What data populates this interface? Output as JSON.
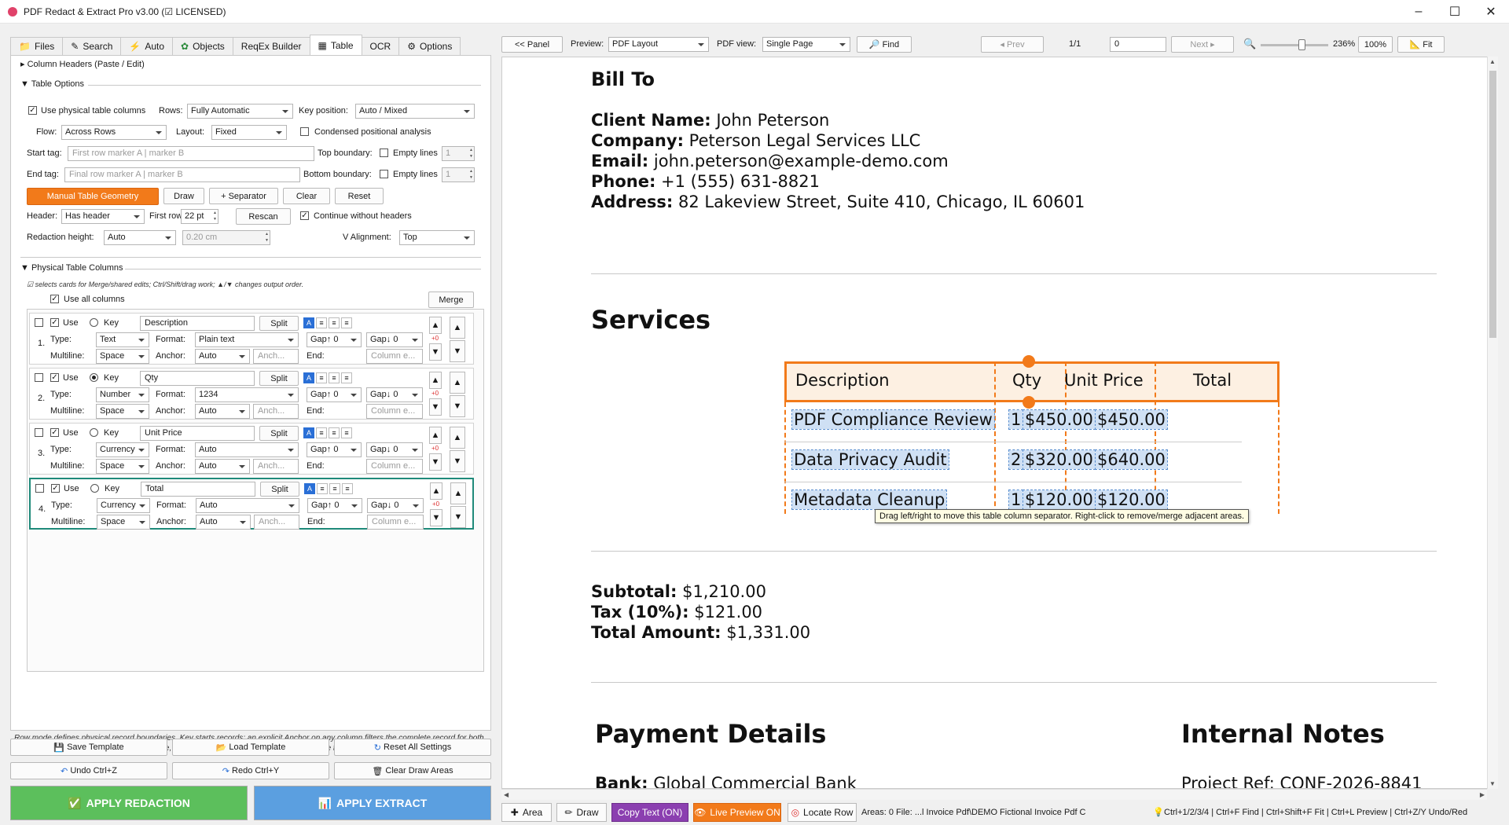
{
  "window": {
    "title": "PDF Redact & Extract Pro v3.00 (☑ LICENSED)"
  },
  "tabs": [
    {
      "label": "Files",
      "icon": "folder-icon"
    },
    {
      "label": "Search",
      "icon": "search-icon"
    },
    {
      "label": "Auto",
      "icon": "lightning-icon"
    },
    {
      "label": "Objects",
      "icon": "objects-icon"
    },
    {
      "label": "ReqEx Builder",
      "icon": ""
    },
    {
      "label": "Table",
      "icon": "table-icon"
    },
    {
      "label": "OCR",
      "icon": ""
    },
    {
      "label": "Options",
      "icon": "gear-icon"
    }
  ],
  "column_headers_section": "Column Headers (Paste / Edit)",
  "table_options": {
    "section": "Table Options",
    "use_physical": "Use physical table columns",
    "rows_label": "Rows:",
    "rows_value": "Fully Automatic",
    "key_position_label": "Key position:",
    "key_position_value": "Auto / Mixed",
    "flow_label": "Flow:",
    "flow_value": "Across Rows",
    "layout_label": "Layout:",
    "layout_value": "Fixed",
    "condensed": "Condensed positional analysis",
    "start_tag_label": "Start tag:",
    "start_tag_placeholder": "First row marker A | marker B",
    "top_boundary_label": "Top boundary:",
    "empty_lines": "Empty lines",
    "top_empty_value": "1",
    "end_tag_label": "End tag:",
    "end_tag_placeholder": "Final row marker A | marker B",
    "bottom_boundary_label": "Bottom boundary:",
    "bottom_empty_value": "1",
    "manual_geometry": "Manual Table Geometry",
    "draw": "Draw",
    "separator": "+ Separator",
    "clear": "Clear",
    "reset": "Reset",
    "header_label": "Header:",
    "header_value": "Has header",
    "first_row_label": "First row:",
    "first_row_value": "22 pt",
    "rescan": "Rescan",
    "continue_without_headers": "Continue without headers",
    "redaction_height_label": "Redaction height:",
    "redaction_height_value": "Auto",
    "redaction_cm": "0.20 cm",
    "valign_label": "V Alignment:",
    "valign_value": "Top"
  },
  "physical_columns": {
    "section": "Physical Table Columns",
    "hint": "☑ selects cards for Merge/shared edits; Ctrl/Shift/drag work; ▲/▼ changes output order.",
    "use_all": "Use all columns",
    "merge": "Merge",
    "labels": {
      "use": "Use",
      "key": "Key",
      "split": "Split",
      "type": "Type:",
      "format": "Format:",
      "multiline": "Multiline:",
      "anchor": "Anchor:",
      "end": "End:",
      "anchor_ph": "Anch...",
      "end_ph": "Column e...",
      "delta": "+0"
    },
    "columns": [
      {
        "num": "1.",
        "name": "Description",
        "type": "Text",
        "format": "Plain text",
        "gap_up": "Gap↑ 0",
        "gap_down": "Gap↓ 0",
        "multiline": "Space",
        "anchor": "Auto",
        "key": false
      },
      {
        "num": "2.",
        "name": "Qty",
        "type": "Number",
        "format": "1234",
        "gap_up": "Gap↑ 0",
        "gap_down": "Gap↓ 0",
        "multiline": "Space",
        "anchor": "Auto",
        "key": true
      },
      {
        "num": "3.",
        "name": "Unit Price",
        "type": "Currency",
        "format": "Auto",
        "gap_up": "Gap↑ 0",
        "gap_down": "Gap↓ 0",
        "multiline": "Space",
        "anchor": "Auto",
        "key": false
      },
      {
        "num": "4.",
        "name": "Total",
        "type": "Currency",
        "format": "Auto",
        "gap_up": "Gap↑ 0",
        "gap_down": "Gap↓ 0",
        "multiline": "Space",
        "anchor": "Auto",
        "key": false
      }
    ]
  },
  "footnote": "Row mode defines physical record boundaries. Key starts records; an explicit Anchor on any column filters the complete record for both Extract and Redact. In Fully Automatic mode, reliable graphic lines are preferred; otherwise the compatible Key-at-top method is used.",
  "bottom_buttons": {
    "save_template": "Save Template",
    "load_template": "Load Template",
    "reset_all": "Reset All Settings",
    "undo": "Undo  Ctrl+Z",
    "redo": "Redo  Ctrl+Y",
    "clear_draw": "Clear Draw Areas",
    "apply_redaction": "APPLY REDACTION",
    "apply_extract": "APPLY EXTRACT"
  },
  "viewer_toolbar": {
    "panel": "<< Panel",
    "preview_label": "Preview:",
    "preview_value": "PDF Layout",
    "pdfview_label": "PDF view:",
    "pdfview_value": "Single Page",
    "find": "Find",
    "prev": "◂ Prev",
    "page": "1/1",
    "page_input": "0",
    "next": "Next ▸",
    "zoom_pct": "236%",
    "zoom_100": "100%",
    "fit": "Fit",
    "zoom_level": 0.6
  },
  "document": {
    "bill_to": "Bill To",
    "fields": [
      {
        "label": "Client Name:",
        "value": "John Peterson"
      },
      {
        "label": "Company:",
        "value": "Peterson Legal Services LLC"
      },
      {
        "label": "Email:",
        "value": "john.peterson@example-demo.com"
      },
      {
        "label": "Phone:",
        "value": "+1 (555) 631-8821"
      },
      {
        "label": "Address:",
        "value": "82 Lakeview Street, Suite 410, Chicago, IL 60601"
      }
    ],
    "services": "Services",
    "table_headers": [
      "Description",
      "Qty",
      "Unit Price",
      "Total"
    ],
    "table_rows": [
      [
        "PDF Compliance Review",
        "1",
        "$450.00",
        "$450.00"
      ],
      [
        "Data Privacy Audit",
        "2",
        "$320.00",
        "$640.00"
      ],
      [
        "Metadata Cleanup",
        "1",
        "$120.00",
        "$120.00"
      ]
    ],
    "tooltip": "Drag left/right to move this table column separator. Right-click to remove/merge adjacent areas.",
    "totals": [
      {
        "label": "Subtotal:",
        "value": "$1,210.00"
      },
      {
        "label": "Tax (10%):",
        "value": "$121.00"
      },
      {
        "label": "Total Amount:",
        "value": "$1,331.00"
      }
    ],
    "payment_details": "Payment Details",
    "internal_notes": "Internal Notes",
    "bank_label": "Bank:",
    "bank_value": "Global Commercial Bank",
    "project_ref": "Project Ref: CONF-2026-8841"
  },
  "statusbar": {
    "area": "Area",
    "draw": "Draw",
    "copy_text": "Copy Text (ON)",
    "live_preview": "Live Preview ON",
    "locate_row": "Locate Row",
    "info": "Areas: 0  File: ...l Invoice Pdf\\DEMO Fictional Invoice Pdf C",
    "shortcuts": "Ctrl+1/2/3/4 | Ctrl+F Find | Ctrl+Shift+F Fit | Ctrl+L Preview | Ctrl+Z/Y Undo/Red"
  },
  "colors": {
    "orange": "#f27a1a",
    "green": "#5cbf5c",
    "blue": "#5b9fe0",
    "purple": "#8b3fb0",
    "teal": "#1f8a7a"
  }
}
